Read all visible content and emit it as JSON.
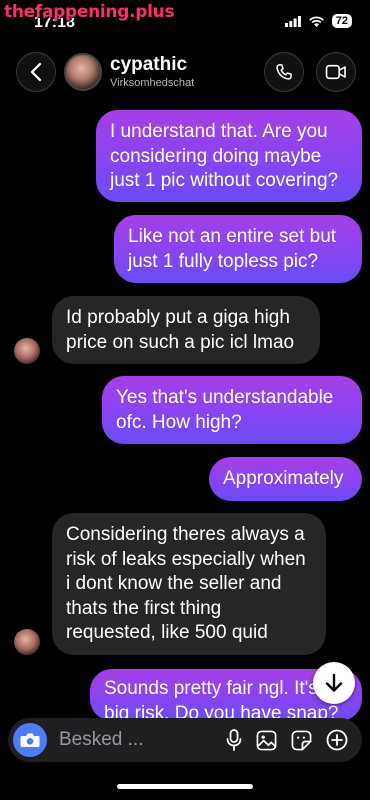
{
  "watermark": "thefappening.plus",
  "status": {
    "time": "17:18",
    "battery": "72"
  },
  "header": {
    "name": "cypathic",
    "subtitle": "Virksomhedschat"
  },
  "messages": [
    {
      "from": "me",
      "text": "I understand that. Are you considering doing maybe just 1 pic without covering?"
    },
    {
      "from": "me",
      "text": "Like not an entire set but just 1 fully topless pic?"
    },
    {
      "from": "them",
      "text": "Id probably put a giga high price on such a pic icl lmao"
    },
    {
      "from": "me",
      "text": "Yes that's understandable ofc. How high?"
    },
    {
      "from": "me",
      "text": "Approximately"
    },
    {
      "from": "them",
      "text": "Considering theres always a risk of leaks especially when i dont know the seller and thats the first thing requested, like 500 quid"
    },
    {
      "from": "me",
      "text": "Sounds pretty fair ngl. It's a big risk. Do you have snap?"
    }
  ],
  "composer": {
    "placeholder": "Besked ..."
  },
  "icons": {
    "back": "chevron-left-icon",
    "call": "phone-icon",
    "video": "video-camera-icon",
    "camera": "camera-icon",
    "mic": "microphone-icon",
    "gallery": "image-icon",
    "sticker": "sticker-icon",
    "add": "plus-circle-icon",
    "scroll": "arrow-down-icon"
  },
  "colors": {
    "accent_from": "#a73fe6",
    "accent_to": "#6a4cf4",
    "incoming": "#262629",
    "camera_button": "#4f7bf7"
  }
}
